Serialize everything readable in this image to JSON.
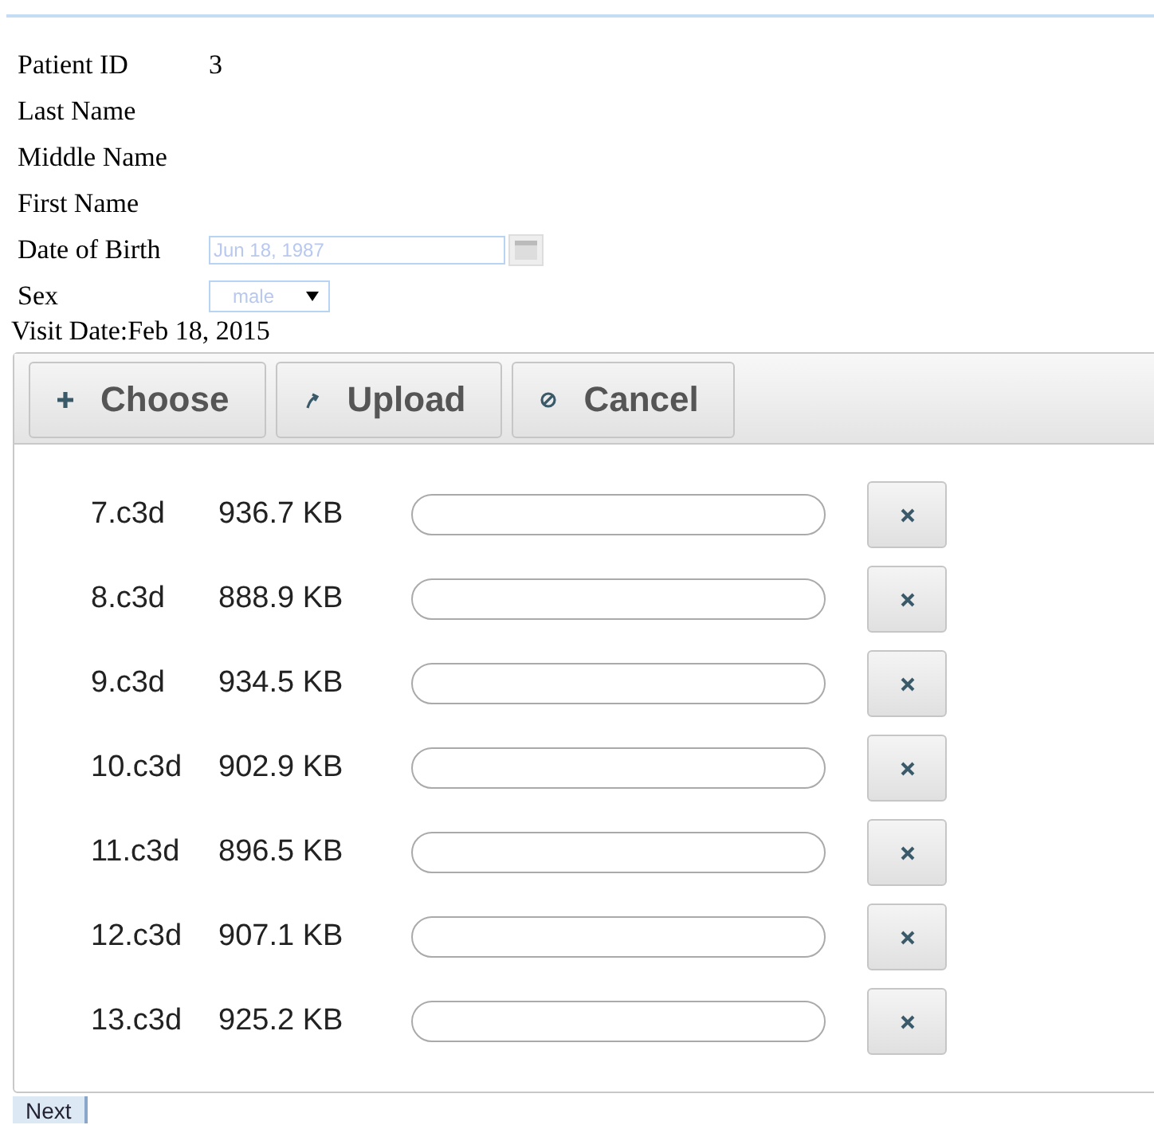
{
  "patient": {
    "fields": [
      {
        "kind": "text",
        "label": "Patient ID",
        "value": "3"
      },
      {
        "kind": "text",
        "label": "Last Name"
      },
      {
        "kind": "text",
        "label": "Middle Name"
      },
      {
        "kind": "text",
        "label": "First Name"
      },
      {
        "kind": "date",
        "label": "Date of Birth",
        "value": "Jun 18, 1987",
        "disabled": true
      },
      {
        "kind": "select",
        "label": "Sex",
        "value": "male",
        "disabled": true
      }
    ],
    "visit_date": "Visit Date:Feb 18, 2015"
  },
  "upload": {
    "buttons": [
      {
        "kind": "choose",
        "label": "Choose"
      },
      {
        "kind": "upload",
        "label": "Upload"
      },
      {
        "kind": "cancel",
        "label": "Cancel"
      }
    ],
    "files": [
      {
        "name": "7.c3d",
        "size": "936.7 KB",
        "level": 0
      },
      {
        "name": "8.c3d",
        "size": "888.9 KB",
        "level": 0
      },
      {
        "name": "9.c3d",
        "size": "934.5 KB",
        "level": 0
      },
      {
        "name": "10.c3d",
        "size": "902.9 KB",
        "level": 0
      },
      {
        "name": "11.c3d",
        "size": "896.5 KB",
        "level": 0
      },
      {
        "name": "12.c3d",
        "size": "907.1 KB",
        "level": 0
      },
      {
        "name": "13.c3d",
        "size": "925.2 KB",
        "level": 0
      }
    ]
  },
  "next_button": "Next"
}
